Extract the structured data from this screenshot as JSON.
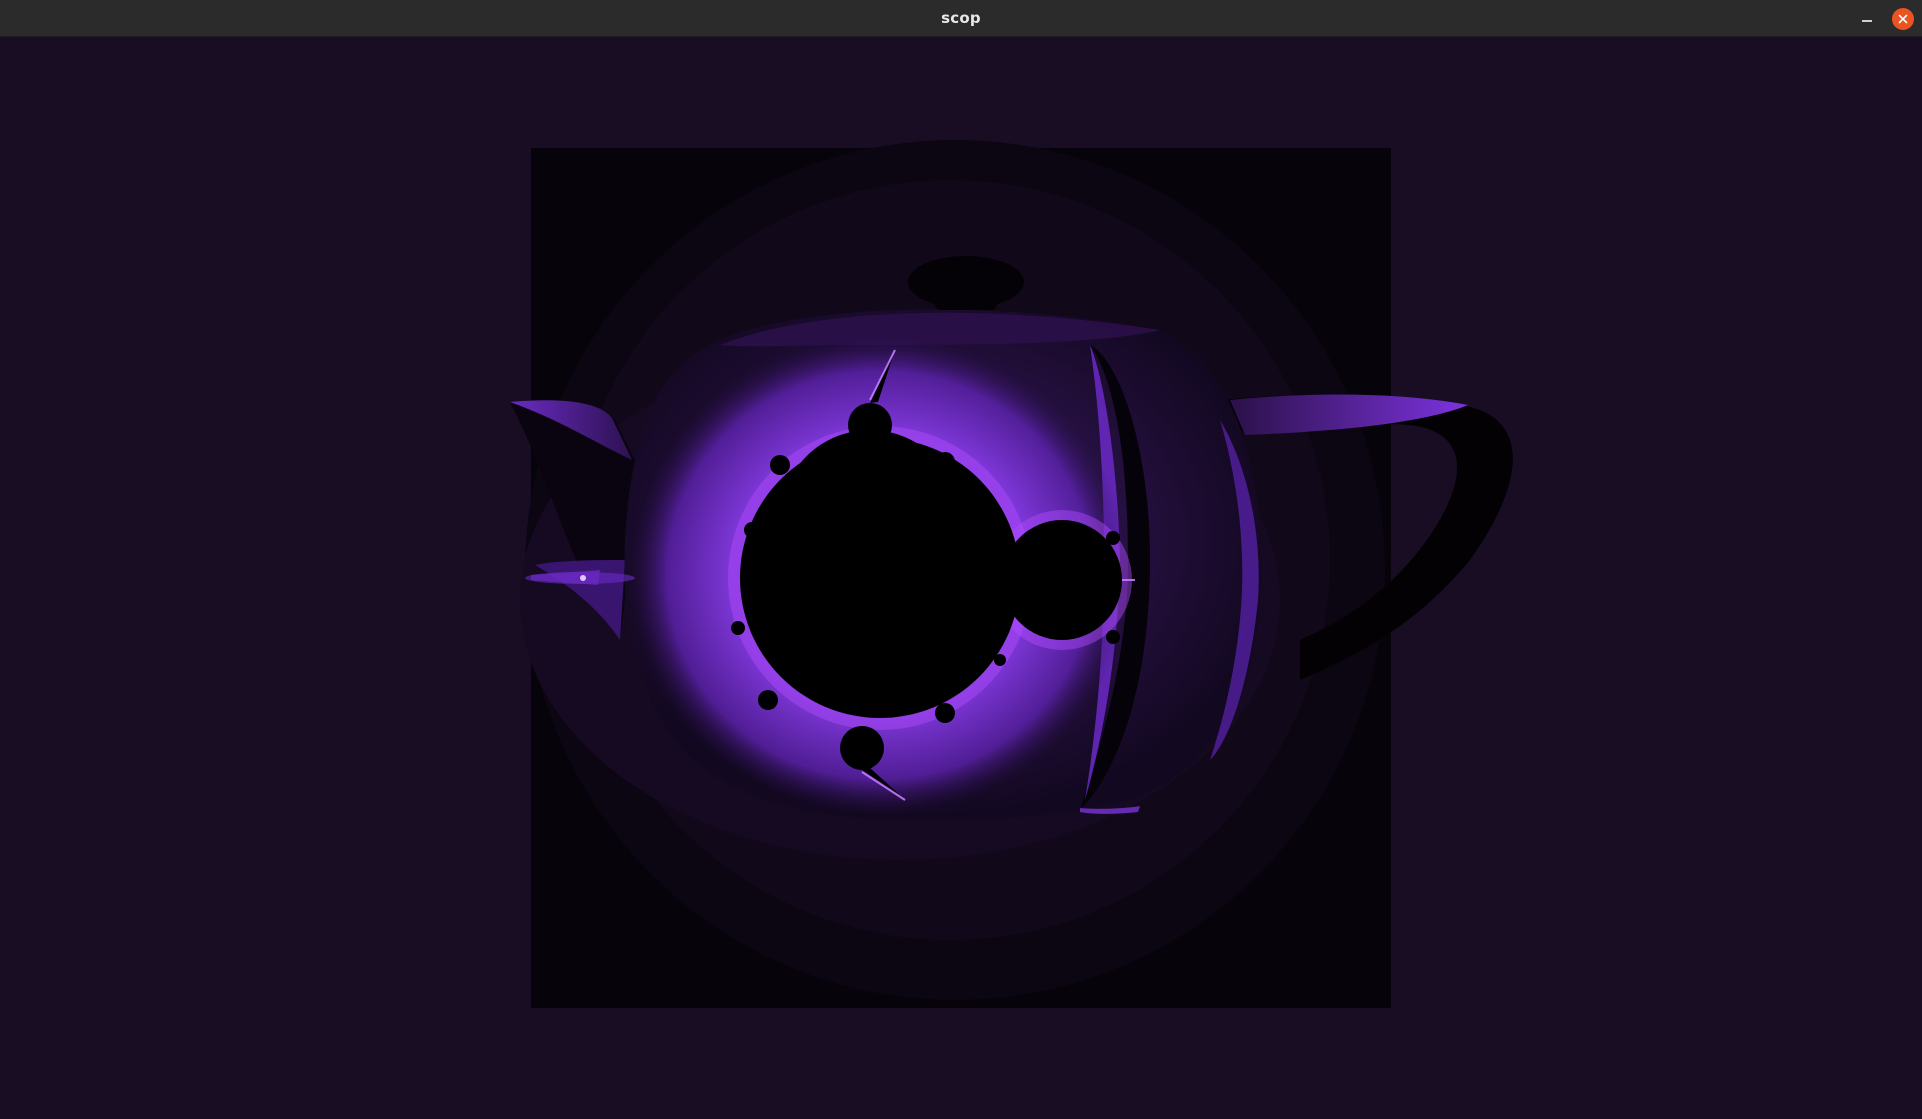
{
  "window": {
    "title": "scop"
  },
  "controls": {
    "minimize_icon": "minimize-icon",
    "close_icon": "close-icon"
  },
  "colors": {
    "titlebar": "#2b2b2b",
    "close_button": "#e95420",
    "viewport_background": "#190d24",
    "texture_square": "#07030b",
    "teapot_body": "#1c0f2b",
    "fractal_glow": "#7a2fd6",
    "fractal_core": "#000000"
  }
}
